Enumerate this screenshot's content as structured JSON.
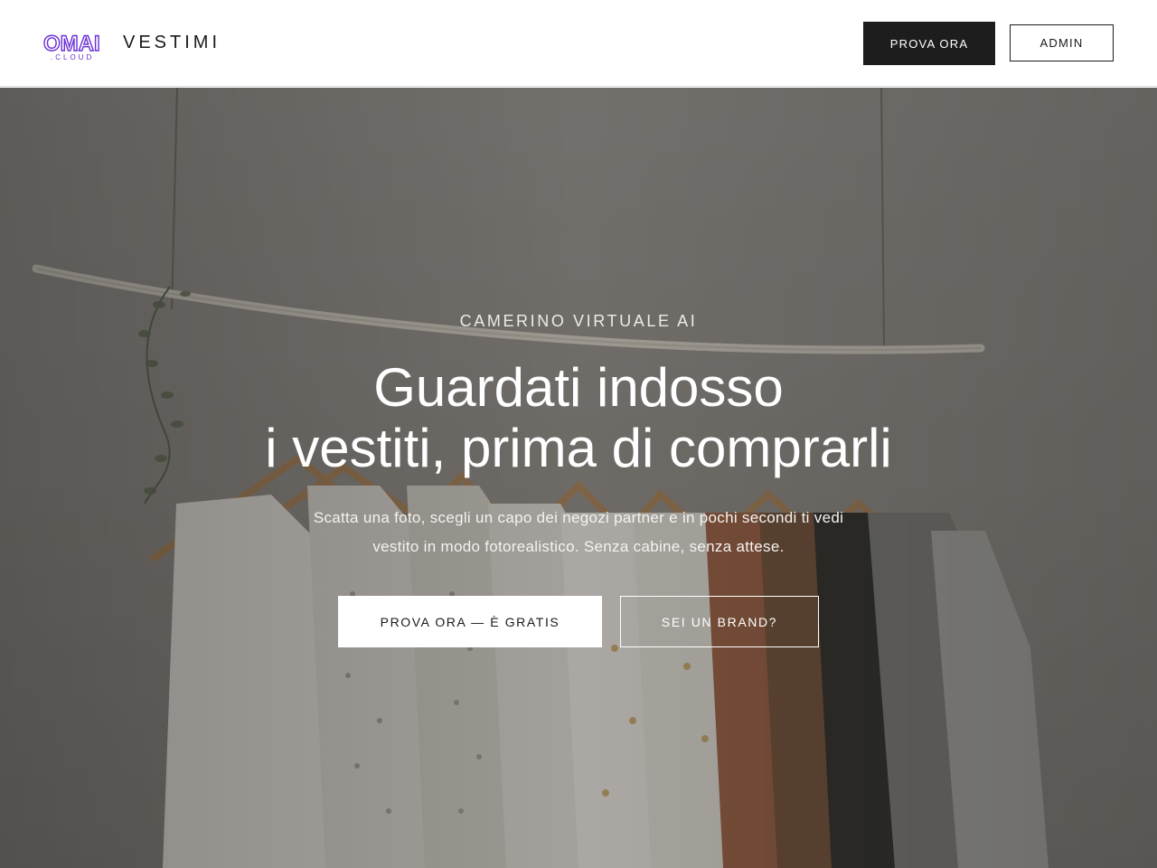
{
  "header": {
    "logo_text": "OMAI",
    "logo_subtext": ".CLOUD",
    "brand_name": "VESTIMI",
    "primary_button": "PROVA ORA",
    "secondary_button": "ADMIN"
  },
  "hero": {
    "eyebrow": "CAMERINO VIRTUALE AI",
    "headline_line1": "Guardati indosso",
    "headline_line2": "i vestiti, prima di comprarli",
    "subtext": "Scatta una foto, scegli un capo dei negozi partner e in pochi secondi ti vedi vestito in modo fotorealistico. Senza cabine, senza attese.",
    "primary_cta": "PROVA ORA — È GRATIS",
    "secondary_cta": "SEI UN BRAND?"
  },
  "colors": {
    "logo_accent": "#6a2fd6",
    "dark_button": "#1d1d1d",
    "hero_overlay": "#5a5753"
  }
}
